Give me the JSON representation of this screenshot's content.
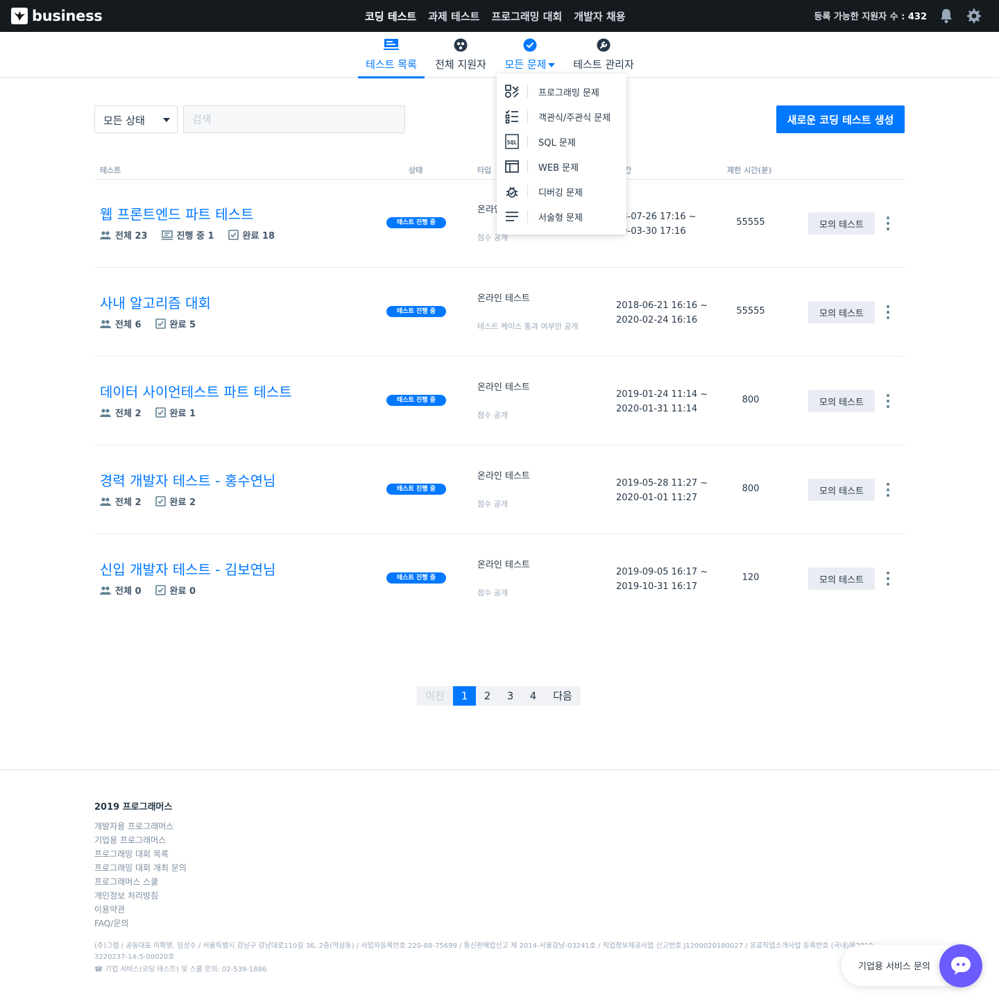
{
  "brand": {
    "logo_text": "business"
  },
  "topnav": {
    "items": [
      {
        "label": "코딩 테스트",
        "active": true
      },
      {
        "label": "과제 테스트",
        "active": false
      },
      {
        "label": "프로그래밍 대회",
        "active": false
      },
      {
        "label": "개발자 채용",
        "active": false
      }
    ],
    "applicant_label": "등록 가능한 지원자 수 :",
    "applicant_count": "432"
  },
  "subnav": {
    "tabs": [
      {
        "label": "테스트 목록",
        "icon": "test-list-icon"
      },
      {
        "label": "전체 지원자",
        "icon": "applicants-icon"
      },
      {
        "label": "모든 문제",
        "icon": "check-circle-icon"
      },
      {
        "label": "테스트 관리자",
        "icon": "wrench-icon"
      }
    ]
  },
  "dropdown": {
    "items": [
      {
        "label": "프로그래밍 문제",
        "icon": "programming-icon"
      },
      {
        "label": "객관식/주관식 문제",
        "icon": "checklist-icon"
      },
      {
        "label": "SQL 문제",
        "icon": "sql-icon"
      },
      {
        "label": "WEB 문제",
        "icon": "web-icon"
      },
      {
        "label": "디버깅 문제",
        "icon": "bug-icon"
      },
      {
        "label": "서술형 문제",
        "icon": "text-lines-icon"
      }
    ]
  },
  "filters": {
    "status_value": "모든 상태",
    "search_placeholder": "검색",
    "create_button": "새로운 코딩 테스트 생성"
  },
  "table": {
    "headers": {
      "test": "테스트",
      "status": "상태",
      "type": "타입",
      "period": "간",
      "limit": "제한 시간(분)"
    },
    "rows": [
      {
        "title": "웹 프론트엔드 파트 테스트",
        "total": "전체 23",
        "in_progress": "진행 중 1",
        "done": "완료 18",
        "status": "테스트 진행 중",
        "type": "온라인",
        "type_sub": "점수 공개",
        "period_start": "18-07-26 17:16 ~",
        "period_end": "20-03-30 17:16",
        "limit": "55555",
        "mock": "모의 테스트"
      },
      {
        "title": "사내 알고리즘 대회",
        "total": "전체 6",
        "done": "완료 5",
        "status": "테스트 진행 중",
        "type": "온라인 테스트",
        "type_sub": "테스트 케이스 통과 여부만 공개",
        "period_start": "2018-06-21 16:16 ~",
        "period_end": "2020-02-24 16:16",
        "limit": "55555",
        "mock": "모의 테스트"
      },
      {
        "title": "데이터 사이언테스트 파트 테스트",
        "total": "전체 2",
        "done": "완료 1",
        "status": "테스트 진행 중",
        "type": "온라인 테스트",
        "type_sub": "점수 공개",
        "period_start": "2019-01-24 11:14 ~",
        "period_end": "2020-01-31 11:14",
        "limit": "800",
        "mock": "모의 테스트"
      },
      {
        "title": "경력 개발자 테스트 - 홍수연님",
        "total": "전체 2",
        "done": "완료 2",
        "status": "테스트 진행 중",
        "type": "온라인 테스트",
        "type_sub": "점수 공개",
        "period_start": "2019-05-28 11:27 ~",
        "period_end": "2020-01-01 11:27",
        "limit": "800",
        "mock": "모의 테스트"
      },
      {
        "title": "신입 개발자 테스트 - 김보연님",
        "total": "전체 0",
        "done": "완료 0",
        "status": "테스트 진행 중",
        "type": "온라인 테스트",
        "type_sub": "점수 공개",
        "period_start": "2019-09-05 16:17 ~",
        "period_end": "2019-10-31 16:17",
        "limit": "120",
        "mock": "모의 테스트"
      }
    ]
  },
  "pagination": {
    "prev": "이전",
    "pages": [
      "1",
      "2",
      "3",
      "4"
    ],
    "current": "1",
    "next": "다음"
  },
  "footer": {
    "title": "2019 프로그래머스",
    "links": [
      "개발자용 프로그래머스",
      "기업용 프로그래머스",
      "프로그래밍 대회 목록",
      "프로그래밍 대회 개최 문의",
      "프로그래머스 스쿨",
      "개인정보 처리방침",
      "이용약관",
      "FAQ/문의"
    ],
    "company_info": "(주)그렙 / 공동대표 이확영, 임성수 / 서울특별시 강남구 강남대로110길 36, 2층(역삼동) / 사업자등록번호 220-88-75699 / 통신판매업신고 제 2014-서울강남-03241호 / 직업정보제공사업 신고번호 J1200020180027 / 유료직업소개사업 등록번호 (국내)제2019-3220237-14-5-00020호",
    "contact": "☎ 기업 서비스(코딩 테스트) 및 스쿨 문의: 02-539-1886"
  },
  "chat": {
    "label": "기업용 서비스 문의"
  },
  "colors": {
    "accent": "#0078ff",
    "topbar": "#151a1f",
    "chat": "#6c5cff"
  }
}
